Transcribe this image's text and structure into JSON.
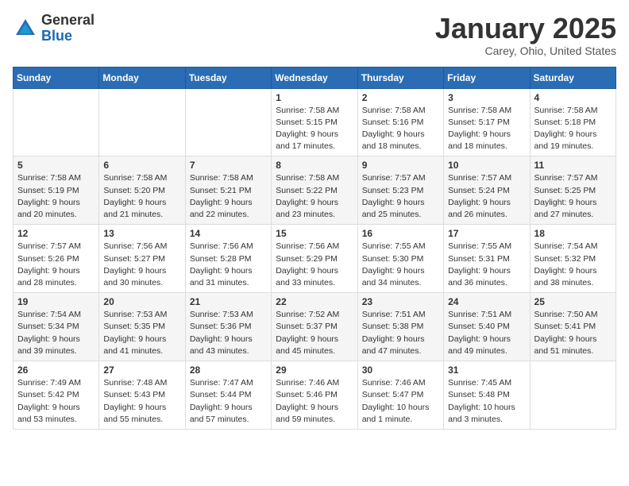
{
  "header": {
    "logo_general": "General",
    "logo_blue": "Blue",
    "month": "January 2025",
    "location": "Carey, Ohio, United States"
  },
  "days_of_week": [
    "Sunday",
    "Monday",
    "Tuesday",
    "Wednesday",
    "Thursday",
    "Friday",
    "Saturday"
  ],
  "weeks": [
    [
      {
        "day": "",
        "sunrise": "",
        "sunset": "",
        "daylight": ""
      },
      {
        "day": "",
        "sunrise": "",
        "sunset": "",
        "daylight": ""
      },
      {
        "day": "",
        "sunrise": "",
        "sunset": "",
        "daylight": ""
      },
      {
        "day": "1",
        "sunrise": "Sunrise: 7:58 AM",
        "sunset": "Sunset: 5:15 PM",
        "daylight": "Daylight: 9 hours and 17 minutes."
      },
      {
        "day": "2",
        "sunrise": "Sunrise: 7:58 AM",
        "sunset": "Sunset: 5:16 PM",
        "daylight": "Daylight: 9 hours and 18 minutes."
      },
      {
        "day": "3",
        "sunrise": "Sunrise: 7:58 AM",
        "sunset": "Sunset: 5:17 PM",
        "daylight": "Daylight: 9 hours and 18 minutes."
      },
      {
        "day": "4",
        "sunrise": "Sunrise: 7:58 AM",
        "sunset": "Sunset: 5:18 PM",
        "daylight": "Daylight: 9 hours and 19 minutes."
      }
    ],
    [
      {
        "day": "5",
        "sunrise": "Sunrise: 7:58 AM",
        "sunset": "Sunset: 5:19 PM",
        "daylight": "Daylight: 9 hours and 20 minutes."
      },
      {
        "day": "6",
        "sunrise": "Sunrise: 7:58 AM",
        "sunset": "Sunset: 5:20 PM",
        "daylight": "Daylight: 9 hours and 21 minutes."
      },
      {
        "day": "7",
        "sunrise": "Sunrise: 7:58 AM",
        "sunset": "Sunset: 5:21 PM",
        "daylight": "Daylight: 9 hours and 22 minutes."
      },
      {
        "day": "8",
        "sunrise": "Sunrise: 7:58 AM",
        "sunset": "Sunset: 5:22 PM",
        "daylight": "Daylight: 9 hours and 23 minutes."
      },
      {
        "day": "9",
        "sunrise": "Sunrise: 7:57 AM",
        "sunset": "Sunset: 5:23 PM",
        "daylight": "Daylight: 9 hours and 25 minutes."
      },
      {
        "day": "10",
        "sunrise": "Sunrise: 7:57 AM",
        "sunset": "Sunset: 5:24 PM",
        "daylight": "Daylight: 9 hours and 26 minutes."
      },
      {
        "day": "11",
        "sunrise": "Sunrise: 7:57 AM",
        "sunset": "Sunset: 5:25 PM",
        "daylight": "Daylight: 9 hours and 27 minutes."
      }
    ],
    [
      {
        "day": "12",
        "sunrise": "Sunrise: 7:57 AM",
        "sunset": "Sunset: 5:26 PM",
        "daylight": "Daylight: 9 hours and 28 minutes."
      },
      {
        "day": "13",
        "sunrise": "Sunrise: 7:56 AM",
        "sunset": "Sunset: 5:27 PM",
        "daylight": "Daylight: 9 hours and 30 minutes."
      },
      {
        "day": "14",
        "sunrise": "Sunrise: 7:56 AM",
        "sunset": "Sunset: 5:28 PM",
        "daylight": "Daylight: 9 hours and 31 minutes."
      },
      {
        "day": "15",
        "sunrise": "Sunrise: 7:56 AM",
        "sunset": "Sunset: 5:29 PM",
        "daylight": "Daylight: 9 hours and 33 minutes."
      },
      {
        "day": "16",
        "sunrise": "Sunrise: 7:55 AM",
        "sunset": "Sunset: 5:30 PM",
        "daylight": "Daylight: 9 hours and 34 minutes."
      },
      {
        "day": "17",
        "sunrise": "Sunrise: 7:55 AM",
        "sunset": "Sunset: 5:31 PM",
        "daylight": "Daylight: 9 hours and 36 minutes."
      },
      {
        "day": "18",
        "sunrise": "Sunrise: 7:54 AM",
        "sunset": "Sunset: 5:32 PM",
        "daylight": "Daylight: 9 hours and 38 minutes."
      }
    ],
    [
      {
        "day": "19",
        "sunrise": "Sunrise: 7:54 AM",
        "sunset": "Sunset: 5:34 PM",
        "daylight": "Daylight: 9 hours and 39 minutes."
      },
      {
        "day": "20",
        "sunrise": "Sunrise: 7:53 AM",
        "sunset": "Sunset: 5:35 PM",
        "daylight": "Daylight: 9 hours and 41 minutes."
      },
      {
        "day": "21",
        "sunrise": "Sunrise: 7:53 AM",
        "sunset": "Sunset: 5:36 PM",
        "daylight": "Daylight: 9 hours and 43 minutes."
      },
      {
        "day": "22",
        "sunrise": "Sunrise: 7:52 AM",
        "sunset": "Sunset: 5:37 PM",
        "daylight": "Daylight: 9 hours and 45 minutes."
      },
      {
        "day": "23",
        "sunrise": "Sunrise: 7:51 AM",
        "sunset": "Sunset: 5:38 PM",
        "daylight": "Daylight: 9 hours and 47 minutes."
      },
      {
        "day": "24",
        "sunrise": "Sunrise: 7:51 AM",
        "sunset": "Sunset: 5:40 PM",
        "daylight": "Daylight: 9 hours and 49 minutes."
      },
      {
        "day": "25",
        "sunrise": "Sunrise: 7:50 AM",
        "sunset": "Sunset: 5:41 PM",
        "daylight": "Daylight: 9 hours and 51 minutes."
      }
    ],
    [
      {
        "day": "26",
        "sunrise": "Sunrise: 7:49 AM",
        "sunset": "Sunset: 5:42 PM",
        "daylight": "Daylight: 9 hours and 53 minutes."
      },
      {
        "day": "27",
        "sunrise": "Sunrise: 7:48 AM",
        "sunset": "Sunset: 5:43 PM",
        "daylight": "Daylight: 9 hours and 55 minutes."
      },
      {
        "day": "28",
        "sunrise": "Sunrise: 7:47 AM",
        "sunset": "Sunset: 5:44 PM",
        "daylight": "Daylight: 9 hours and 57 minutes."
      },
      {
        "day": "29",
        "sunrise": "Sunrise: 7:46 AM",
        "sunset": "Sunset: 5:46 PM",
        "daylight": "Daylight: 9 hours and 59 minutes."
      },
      {
        "day": "30",
        "sunrise": "Sunrise: 7:46 AM",
        "sunset": "Sunset: 5:47 PM",
        "daylight": "Daylight: 10 hours and 1 minute."
      },
      {
        "day": "31",
        "sunrise": "Sunrise: 7:45 AM",
        "sunset": "Sunset: 5:48 PM",
        "daylight": "Daylight: 10 hours and 3 minutes."
      },
      {
        "day": "",
        "sunrise": "",
        "sunset": "",
        "daylight": ""
      }
    ]
  ]
}
